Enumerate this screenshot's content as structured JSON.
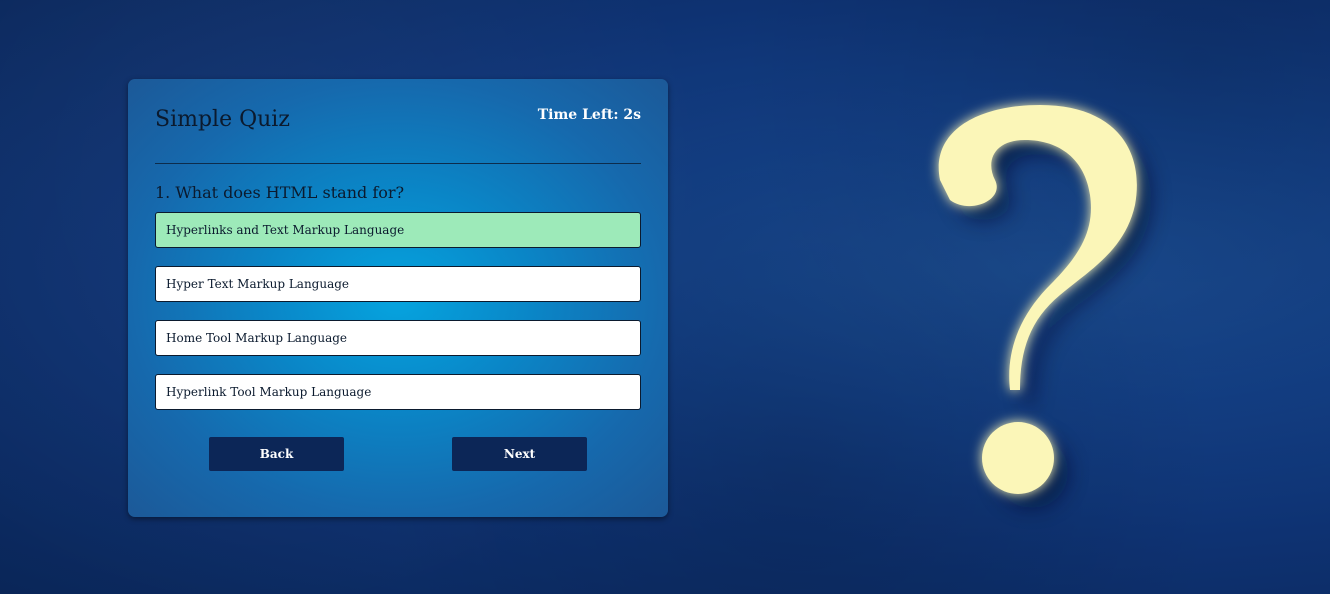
{
  "quiz": {
    "title": "Simple Quiz",
    "timer": "Time Left: 2s",
    "question": "1. What does HTML stand for?",
    "options": [
      {
        "label": "Hyperlinks and Text Markup Language",
        "selected": true
      },
      {
        "label": "Hyper Text Markup Language",
        "selected": false
      },
      {
        "label": "Home Tool Markup Language",
        "selected": false
      },
      {
        "label": "Hyperlink Tool Markup Language",
        "selected": false
      }
    ],
    "back_label": "Back",
    "next_label": "Next"
  },
  "background": {
    "decoration_icon": "question-mark-icon"
  },
  "colors": {
    "selected_option": "#9deab9",
    "button": "#0c2657",
    "card_center": "#05a4df"
  }
}
